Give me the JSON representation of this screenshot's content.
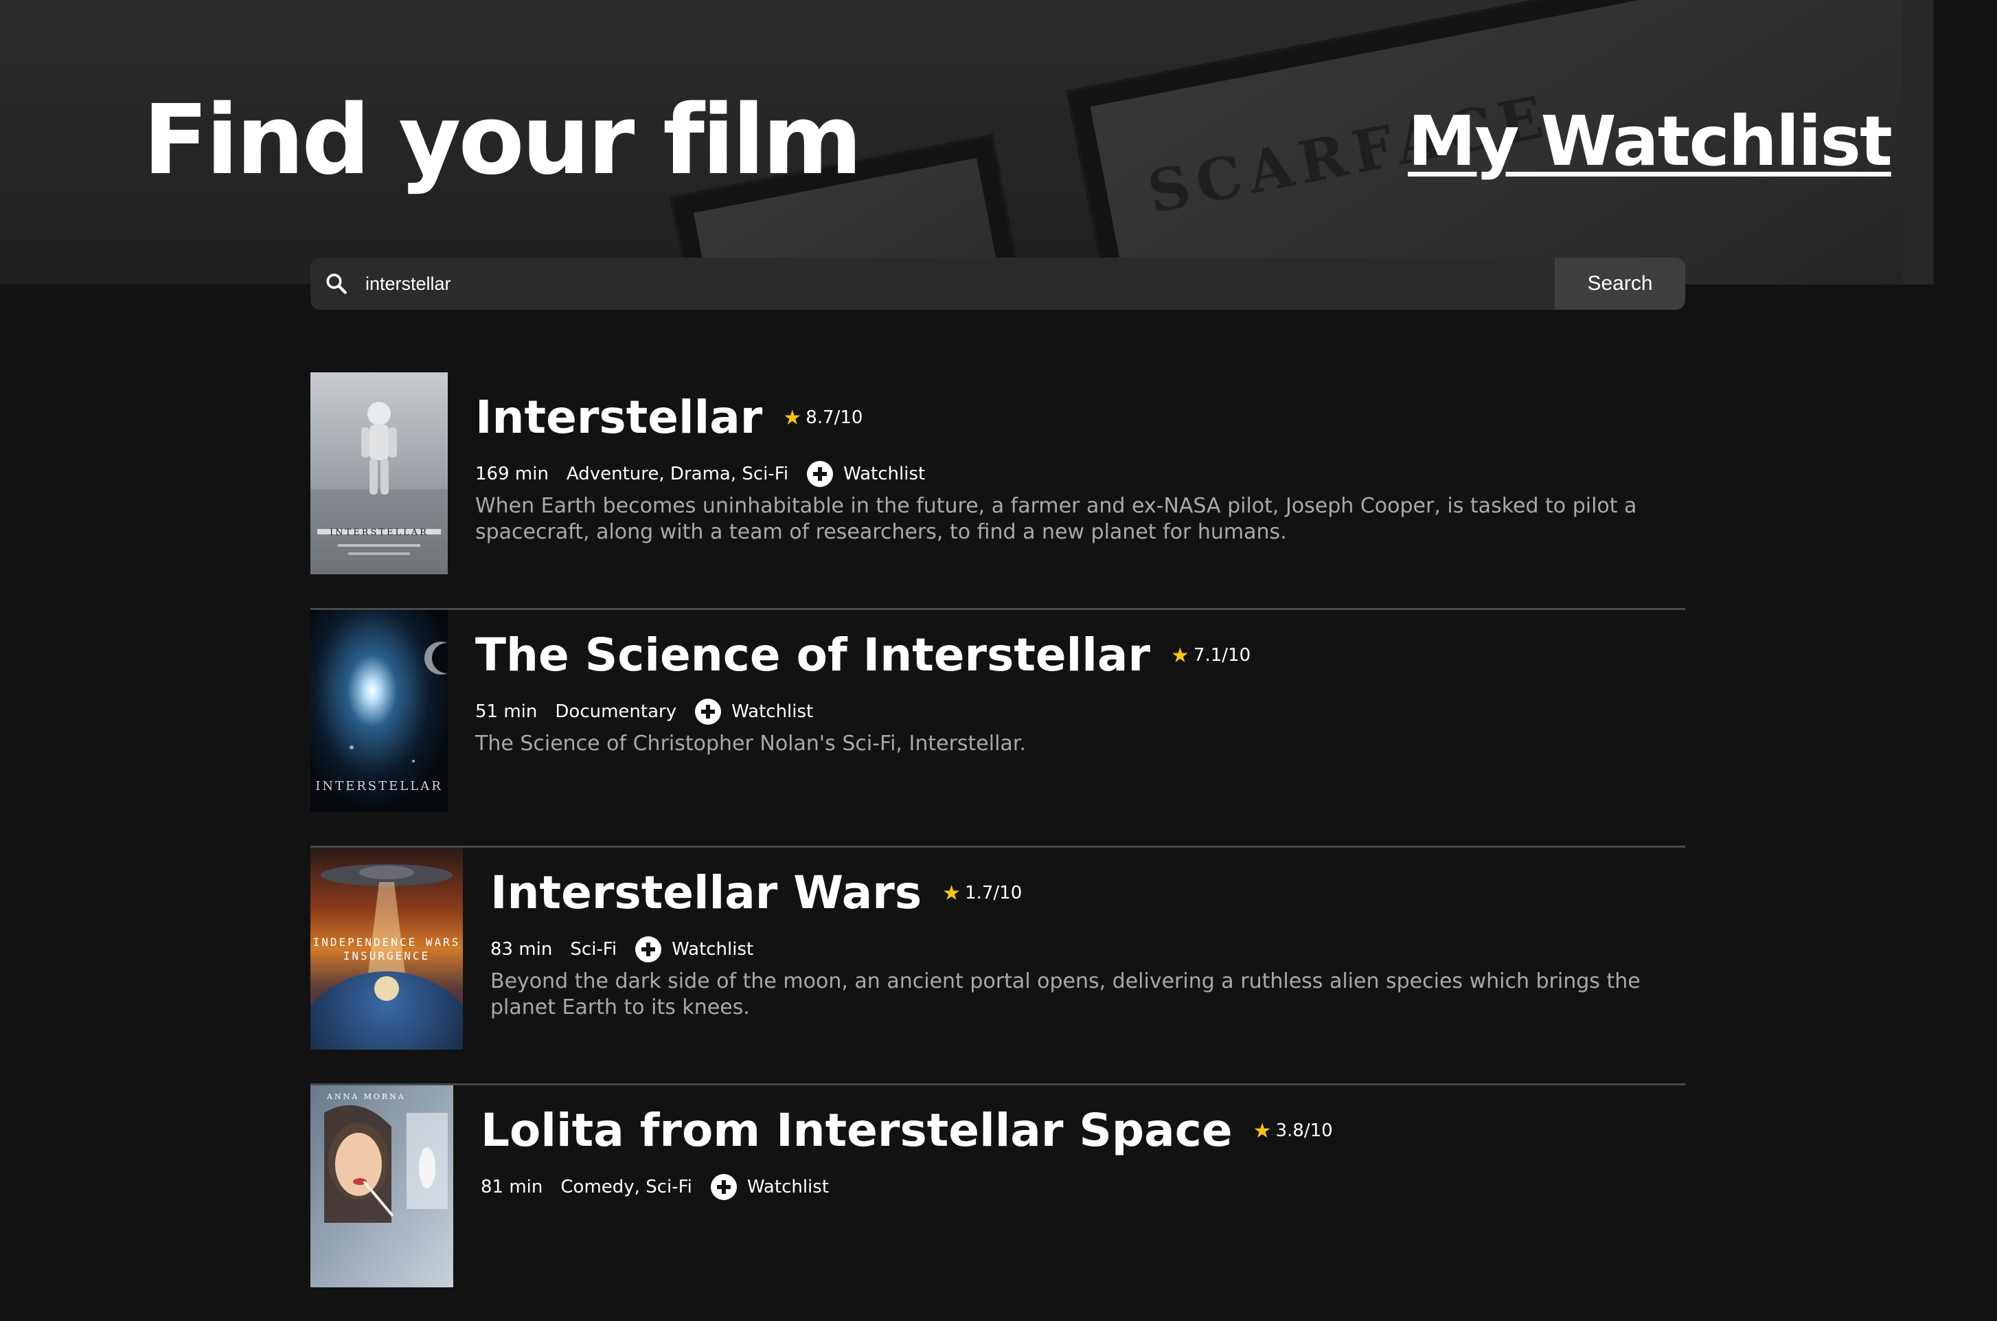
{
  "header": {
    "title": "Find your film",
    "watchlist_link": "My Watchlist",
    "background_poster_text": "SCARFACE"
  },
  "search": {
    "value": "interstellar",
    "button_label": "Search",
    "icon": "search-icon"
  },
  "results": [
    {
      "title": "Interstellar",
      "rating": "8.7/10",
      "runtime": "169 min",
      "genres": "Adventure, Drama, Sci-Fi",
      "watchlist_label": "Watchlist",
      "overview": "When Earth becomes uninhabitable in the future, a farmer and ex-NASA pilot, Joseph Cooper, is tasked to pilot a spacecraft, along with a team of researchers, to find a new planet for humans.",
      "poster_text": "INTERSTELLAR"
    },
    {
      "title": "The Science of Interstellar",
      "rating": "7.1/10",
      "runtime": "51 min",
      "genres": "Documentary",
      "watchlist_label": "Watchlist",
      "overview": "The Science of Christopher Nolan's Sci-Fi, Interstellar.",
      "poster_text": "INTERSTELLAR"
    },
    {
      "title": "Interstellar Wars",
      "rating": "1.7/10",
      "runtime": "83 min",
      "genres": "Sci-Fi",
      "watchlist_label": "Watchlist",
      "overview": "Beyond the dark side of the moon, an ancient portal opens, delivering a ruthless alien species which brings the planet Earth to its knees.",
      "poster_text": "INDEPENDENCE WARS INSURGENCE"
    },
    {
      "title": "Lolita from Interstellar Space",
      "rating": "3.8/10",
      "runtime": "81 min",
      "genres": "Comedy, Sci-Fi",
      "watchlist_label": "Watchlist",
      "overview": "",
      "poster_text": "ANNA MORNA"
    }
  ],
  "colors": {
    "background": "#121212",
    "search_bar": "#2b2b2b",
    "search_button": "#3e3e3e",
    "rating_star": "#f5c518",
    "overview_text": "#a9a9a9",
    "divider": "#4a4a4a"
  }
}
